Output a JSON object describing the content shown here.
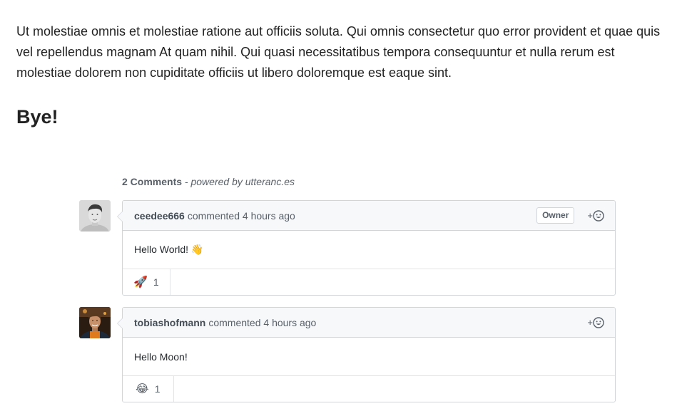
{
  "article": {
    "paragraph": "Ut molestiae omnis et molestiae ratione aut officiis soluta. Qui omnis consectetur quo error provident et quae quis vel repellendus magnam At quam nihil. Qui quasi necessitatibus tempora consequuntur et nulla rerum est molestiae dolorem non cupiditate officiis ut libero doloremque est eaque sint.",
    "heading": "Bye!"
  },
  "comments_header": {
    "count_label": "2 Comments",
    "powered_label": " - powered by utteranc.es"
  },
  "comments": [
    {
      "author": "ceedee666",
      "action": "commented",
      "time": "4 hours ago",
      "badge": "Owner",
      "add_reaction": "+",
      "body": "Hello World! 👋",
      "reaction_emoji": "🚀",
      "reaction_count": "1"
    },
    {
      "author": "tobiashofmann",
      "action": "commented",
      "time": "4 hours ago",
      "add_reaction": "+",
      "body": "Hello Moon!",
      "reaction_emoji": "😂",
      "reaction_count": "1"
    }
  ],
  "icons": {
    "smiley": "smiley-icon",
    "avatar": "avatar-photo"
  },
  "colors": {
    "border": "#d1d5da",
    "header_bg": "#f6f8fa",
    "muted_text": "#586069"
  }
}
